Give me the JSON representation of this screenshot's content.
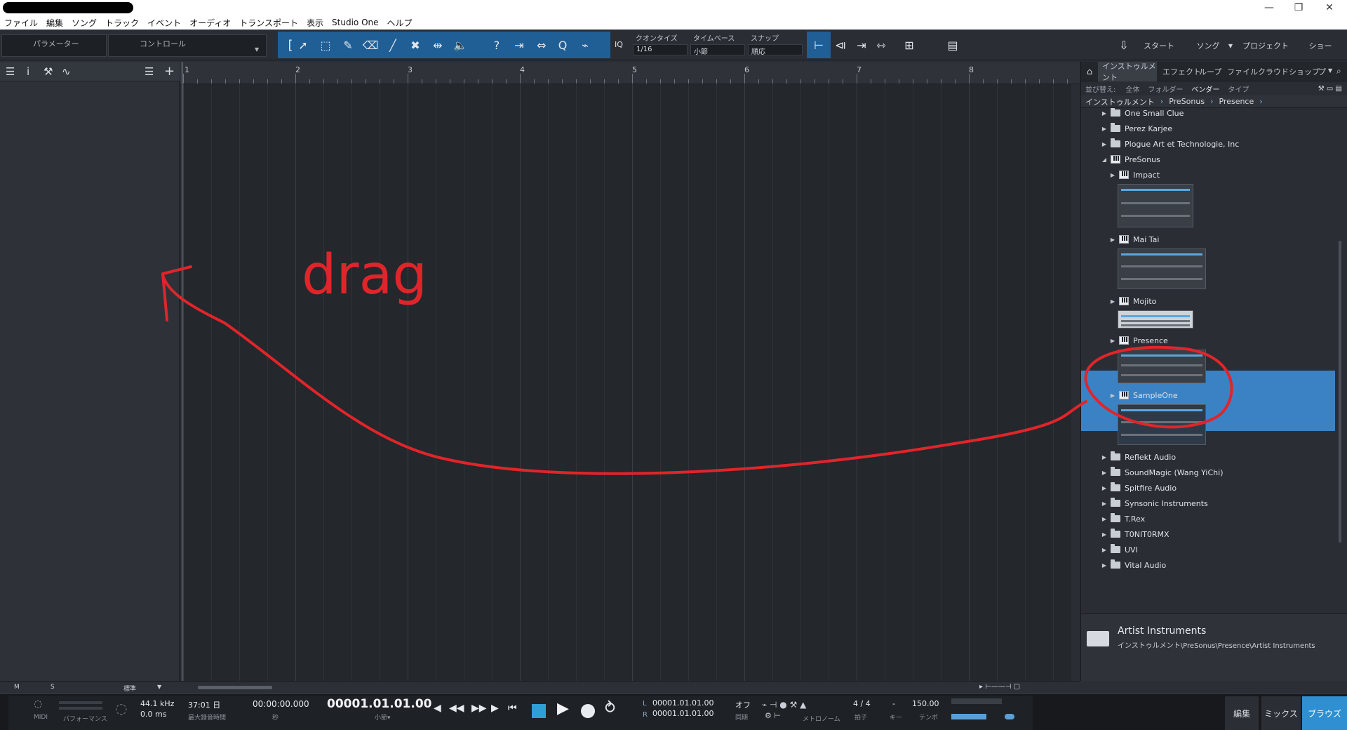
{
  "window": {
    "title_redacted": true,
    "min_icon": "minimize-icon",
    "max_icon": "restore-icon",
    "close_icon": "close-icon"
  },
  "menu": [
    "ファイル",
    "編集",
    "ソング",
    "トラック",
    "イベント",
    "オーディオ",
    "トランスポート",
    "表示",
    "Studio One",
    "ヘルプ"
  ],
  "toolbar": {
    "param_label": "パラメーター",
    "control_label": "コントロール",
    "quantize_title": "クオンタイズ",
    "quantize_value": "1/16",
    "timebase_title": "タイムベース",
    "timebase_value": "小節",
    "snap_title": "スナップ",
    "snap_value": "順応",
    "iq": "IQ",
    "start": "スタート",
    "song": "ソング",
    "project": "プロジェクト",
    "show": "ショー"
  },
  "ruler": {
    "bars": [
      "1",
      "2",
      "3",
      "4",
      "5",
      "6",
      "7",
      "8"
    ]
  },
  "annotation": {
    "text": "drag",
    "color": "#e0252a"
  },
  "trackfoot": {
    "m": "M",
    "s": "S",
    "zoom_mode": "標準"
  },
  "transport": {
    "midi_label": "MIDI",
    "perf_label": "パフォーマンス",
    "sample_rate": "44.1 kHz",
    "latency": "0.0 ms",
    "record_time": "37:01 日",
    "record_time_label": "最大録音時間",
    "seconds": "00:00:00.000",
    "seconds_label": "秒",
    "bars_pos": "00001.01.01.00",
    "bars_label": "小節▾",
    "loop_l": "00001.01.01.00",
    "loop_r": "00001.01.01.00",
    "loop_l_label": "L",
    "loop_r_label": "R",
    "sync_value": "オフ",
    "sync_label": "同期",
    "metronome_label": "メトロノーム",
    "signature": "4 / 4",
    "signature_label": "拍子",
    "key_value": "-",
    "key_label": "キー",
    "tempo": "150.00",
    "tempo_label": "テンポ"
  },
  "bottom_tabs": [
    "編集",
    "ミックス",
    "ブラウズ"
  ],
  "browser": {
    "tabs": [
      "インストゥルメント",
      "エフェクト",
      "ループ",
      "ファイル",
      "クラウド",
      "ショップ",
      "プ"
    ],
    "sort_label": "並び替え:",
    "sort_options": [
      "全体",
      "フォルダー",
      "ベンダー",
      "タイプ"
    ],
    "breadcrumb": [
      "インストゥルメント",
      "PreSonus",
      "Presence"
    ],
    "items": [
      {
        "label": "One Small Clue",
        "kind": "folder",
        "depth": 1
      },
      {
        "label": "Perez Karjee",
        "kind": "folder",
        "depth": 1
      },
      {
        "label": "Plogue Art et Technologie, Inc",
        "kind": "folder",
        "depth": 1
      },
      {
        "label": "PreSonus",
        "kind": "vendor",
        "depth": 1
      },
      {
        "label": "Impact",
        "kind": "instrument",
        "depth": 2
      },
      {
        "label": "Mai Tai",
        "kind": "instrument",
        "depth": 2
      },
      {
        "label": "Mojito",
        "kind": "instrument",
        "depth": 2
      },
      {
        "label": "Presence",
        "kind": "instrument",
        "depth": 2,
        "selected": true
      },
      {
        "label": "SampleOne",
        "kind": "instrument",
        "depth": 2
      },
      {
        "label": "Reflekt Audio",
        "kind": "folder",
        "depth": 1
      },
      {
        "label": "SoundMagic (Wang YiChi)",
        "kind": "folder",
        "depth": 1
      },
      {
        "label": "Spitfire Audio",
        "kind": "folder",
        "depth": 1
      },
      {
        "label": "Synsonic Instruments",
        "kind": "folder",
        "depth": 1
      },
      {
        "label": "T.Rex",
        "kind": "folder",
        "depth": 1
      },
      {
        "label": "T0NIT0RMX",
        "kind": "folder",
        "depth": 1
      },
      {
        "label": "UVI",
        "kind": "folder",
        "depth": 1
      },
      {
        "label": "Vital Audio",
        "kind": "folder",
        "depth": 1
      }
    ],
    "footer_title": "Artist Instruments",
    "footer_path": "インストゥルメント\\PreSonus\\Presence\\Artist Instruments",
    "selection_color": "#3b82c4"
  }
}
